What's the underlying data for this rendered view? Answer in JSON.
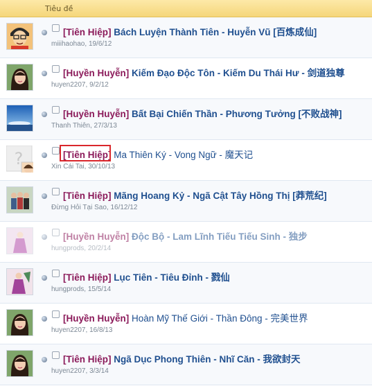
{
  "header": {
    "title_column": "Tiêu đề"
  },
  "threads": [
    {
      "prefix": "[Tiên Hiệp]",
      "title": "Bách Luyện Thành Tiên - Huyễn Vũ [百炼成仙]",
      "author": "miiihaohao",
      "date": "19/6/12",
      "bold": true,
      "avatar": "cartoon-boy"
    },
    {
      "prefix": "[Huyền Huyễn]",
      "title": "Kiếm Đạo Độc Tôn - Kiếm Du Thái Hư - 剑道独尊",
      "author": "huyen2207",
      "date": "9/2/12",
      "bold": true,
      "avatar": "girl-photo"
    },
    {
      "prefix": "[Huyền Huyễn]",
      "title": "Bất Bại Chiến Thần - Phương Tưởng [不败战神]",
      "author": "Thanh Thiên",
      "date": "27/3/13",
      "bold": true,
      "avatar": "sky-photo"
    },
    {
      "prefix": "[Tiên Hiệp]",
      "title": "Ma Thiên Ký - Vong Ngữ - 魔天记",
      "author": "Xin Cái Tai",
      "date": "30/10/13",
      "bold": false,
      "avatar": "unknown-user"
    },
    {
      "prefix": "[Tiên Hiệp]",
      "title": "Mãng Hoang Kỷ - Ngã Cật Tây Hồng Thị [莽荒纪]",
      "author": "Đừng Hỏi Tại Sao",
      "date": "16/12/12",
      "bold": true,
      "avatar": "group-photo"
    },
    {
      "prefix": "[Huyền Huyễn]",
      "title": "Độc Bộ - Lam Lĩnh Tiếu Tiếu Sinh - 独步",
      "author": "hungprods",
      "date": "20/2/14",
      "bold": true,
      "avatar": "costume-photo"
    },
    {
      "prefix": "[Tiên Hiệp]",
      "title": "Lục Tiên - Tiêu Đỉnh - 戮仙",
      "author": "hungprods",
      "date": "15/5/14",
      "bold": true,
      "avatar": "costume-photo"
    },
    {
      "prefix": "[Huyền Huyễn]",
      "title": "Hoàn Mỹ Thế Giới - Thần Đông - 完美世界",
      "author": "huyen2207",
      "date": "16/8/13",
      "bold": false,
      "avatar": "girl-photo"
    },
    {
      "prefix": "[Tiên Hiệp]",
      "title": "Ngã Dục Phong Thiên - Nhĩ Căn - 我欲封天",
      "author": "huyen2207",
      "date": "3/3/14",
      "bold": true,
      "avatar": "girl-photo"
    }
  ]
}
